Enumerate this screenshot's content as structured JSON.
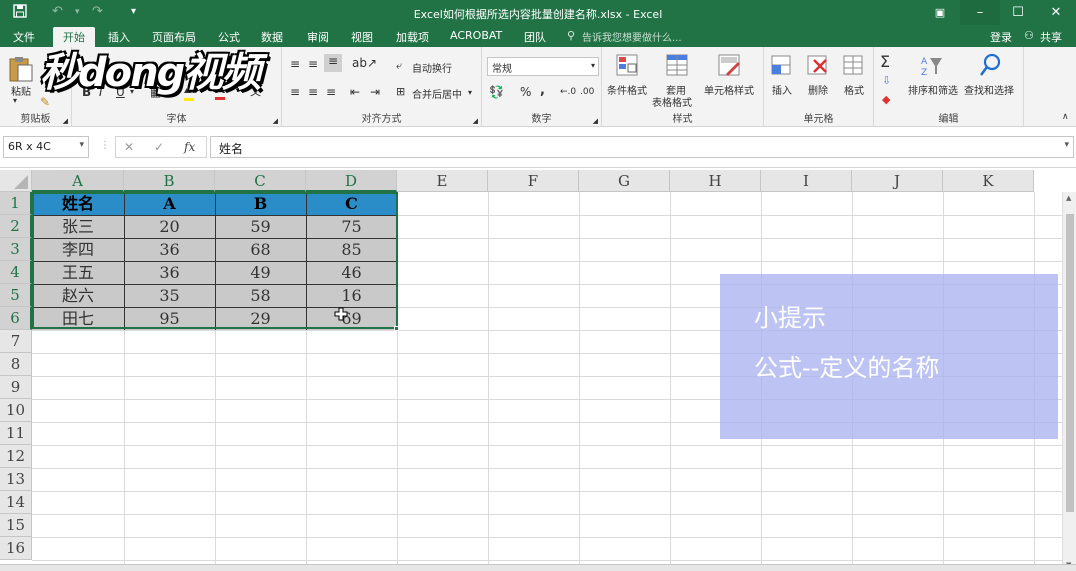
{
  "title_bar": {
    "title": "Excel如何根据所选内容批量创建名称.xlsx - Excel",
    "save_icon": "save-icon",
    "undo_icon": "undo-icon",
    "redo_icon": "redo-icon",
    "customize_icon": "customize-quick-access-icon",
    "ribbon_display_icon": "ribbon-display-options-icon",
    "minimize_glyph": "–",
    "maximize_glyph": "☐",
    "close_glyph": "✕"
  },
  "tabs": [
    "文件",
    "开始",
    "插入",
    "页面布局",
    "公式",
    "数据",
    "审阅",
    "视图",
    "加载项",
    "ACROBAT",
    "团队"
  ],
  "active_tab": "开始",
  "tell_me": "告诉我您想要做什么...",
  "login": "登录",
  "share": "共享",
  "watermark": "秒dong视频",
  "ribbon": {
    "groups": {
      "clipboard": "剪贴板",
      "font": "字体",
      "alignment": "对齐方式",
      "number": "数字",
      "styles": "样式",
      "cells": "单元格",
      "editing": "编辑"
    },
    "paste": "粘贴",
    "bold": "B",
    "italic": "I",
    "underline": "U",
    "wrap_text": "自动换行",
    "merge_center": "合并后居中",
    "number_format": "常规",
    "percent": "%",
    "comma": ",",
    "inc_decimal": "←.0",
    "dec_decimal": ".00",
    "conditional_format": "条件格式",
    "format_table_1": "套用",
    "format_table_2": "表格格式",
    "cell_styles": "单元格样式",
    "insert": "插入",
    "delete": "删除",
    "format": "格式",
    "sigma": "Σ",
    "sort_filter": "排序和筛选",
    "find_select": "查找和选择"
  },
  "formula_bar": {
    "name_box": "6R x 4C",
    "cancel": "✕",
    "enter": "✓",
    "fx": "fx",
    "content": "姓名"
  },
  "columns": [
    "A",
    "B",
    "C",
    "D",
    "E",
    "F",
    "G",
    "H",
    "I",
    "J",
    "K"
  ],
  "rows": [
    "1",
    "2",
    "3",
    "4",
    "5",
    "6",
    "7",
    "8",
    "9",
    "10",
    "11",
    "12",
    "13",
    "14",
    "15",
    "16"
  ],
  "table": {
    "header": [
      "姓名",
      "A",
      "B",
      "C"
    ],
    "rows": [
      [
        "张三",
        "20",
        "59",
        "75"
      ],
      [
        "李四",
        "36",
        "68",
        "85"
      ],
      [
        "王五",
        "36",
        "49",
        "46"
      ],
      [
        "赵六",
        "35",
        "58",
        "16"
      ],
      [
        "田七",
        "95",
        "29",
        "69"
      ]
    ]
  },
  "tip": {
    "line1": "小提示",
    "line2": "公式--定义的名称"
  },
  "colors": {
    "excel_green": "#217346",
    "header_fill": "#2b8dc8",
    "body_fill": "#c9c9c9",
    "tip_fill": "#aab4f0"
  }
}
